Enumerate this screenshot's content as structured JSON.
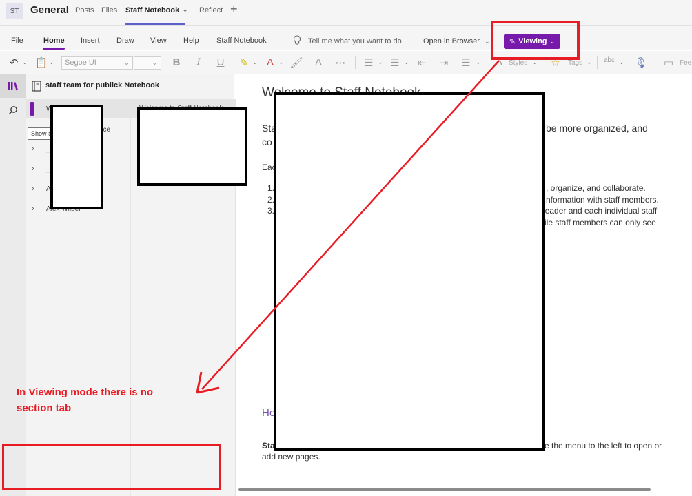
{
  "teams": {
    "avatar": "ST",
    "channel": "General",
    "tabs": [
      "Posts",
      "Files",
      "Staff Notebook",
      "Reflect"
    ],
    "add_tab": "+",
    "dropdown": "⌄"
  },
  "ribbon": {
    "tabs": [
      "File",
      "Home",
      "Insert",
      "Draw",
      "View",
      "Help",
      "Staff Notebook"
    ],
    "tell_me": "Tell me what you want to do",
    "open_in_browser": "Open in Browser",
    "viewing_label": "Viewing",
    "font_name": "Segoe UI",
    "styles_label": "Styles",
    "tags_label": "Tags",
    "feedback_label": "Fee"
  },
  "notebook": {
    "title": "staff team for publick Notebook",
    "tooltip": "Show S",
    "sections": [
      {
        "label": "W"
      },
      {
        "label": "ace"
      },
      {
        "label": "_"
      },
      {
        "label": "_"
      },
      {
        "label": "A"
      },
      {
        "label": "Alex Wilber"
      }
    ],
    "page": "Welcome to Staff Notebook"
  },
  "content": {
    "title": "Welcome to Staff Notebook",
    "intro_1_left": "Sta",
    "intro_1_right": "be more organized, and",
    "intro_2_left": "co",
    "each_prefix": "Eac",
    "list_nums": [
      "1.",
      "2.",
      "3."
    ],
    "list_right": [
      ", organize, and collaborate.",
      "nformation with staff members.",
      "leader and each individual staff",
      "ile staff members can only see"
    ],
    "heading_prefix": "Ho",
    "bottom_line_1_left": "Sta",
    "bottom_line_1_right": "e the menu to the left to open or",
    "bottom_line_2": "add new pages."
  },
  "annotation": {
    "text": "In Viewing mode there is no section tab"
  },
  "colors": {
    "accent": "#7719aa",
    "annotation_red": "#e81c24",
    "teams_accent": "#5b5fc7"
  }
}
